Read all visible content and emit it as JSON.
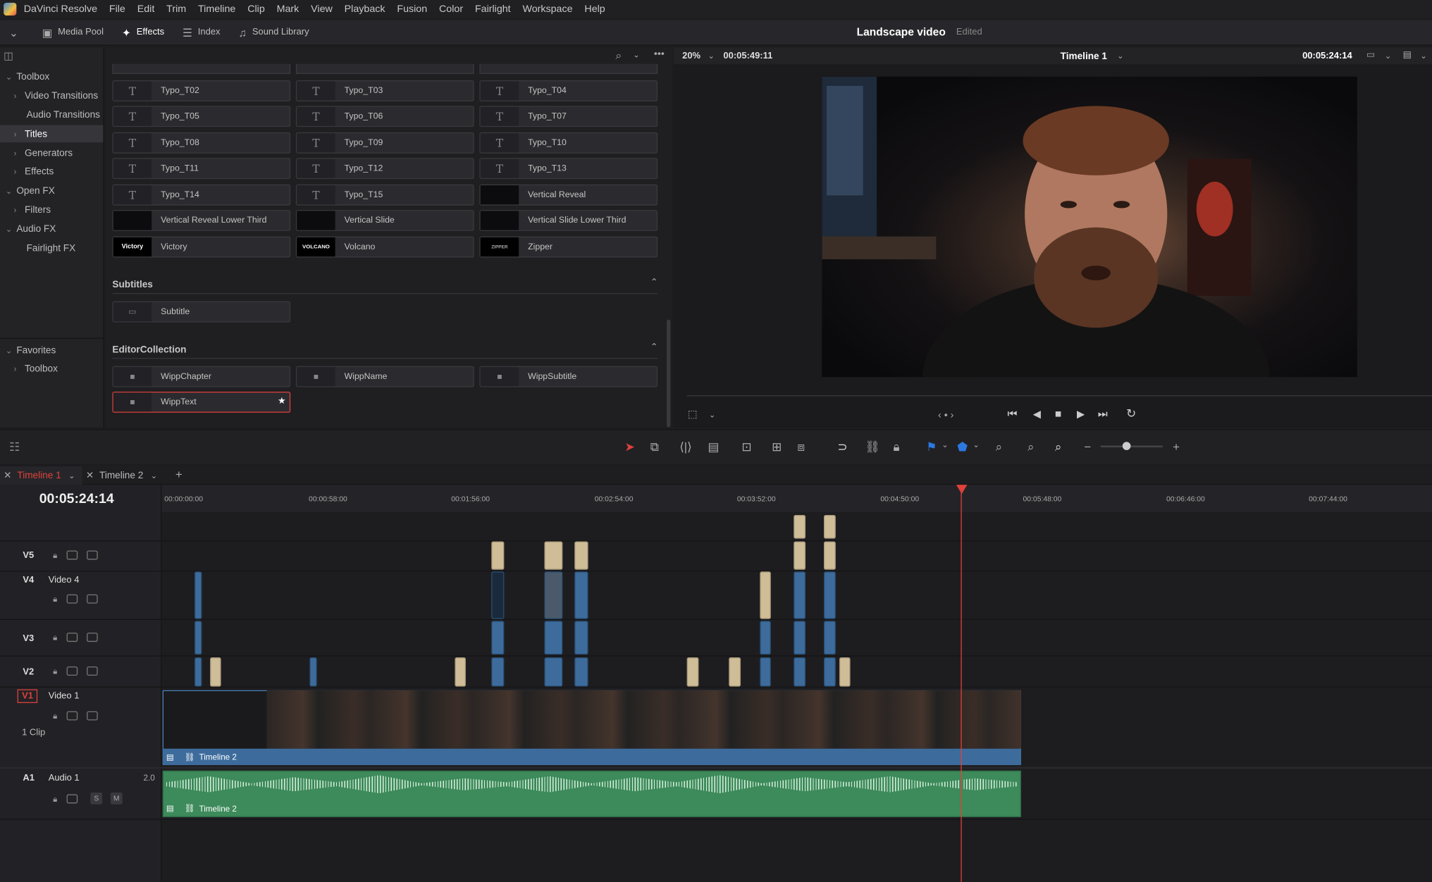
{
  "app_title": "DaVinci Resolve",
  "menu": [
    "File",
    "Edit",
    "Trim",
    "Timeline",
    "Clip",
    "Mark",
    "View",
    "Playback",
    "Fusion",
    "Color",
    "Fairlight",
    "Workspace",
    "Help"
  ],
  "page_tabs": [
    {
      "label": "Media Pool",
      "icon": "media-pool-icon"
    },
    {
      "label": "Effects",
      "icon": "effects-wand-icon",
      "active": true
    },
    {
      "label": "Index",
      "icon": "index-list-icon"
    },
    {
      "label": "Sound Library",
      "icon": "sound-library-icon"
    }
  ],
  "project": {
    "title": "Landscape video",
    "status": "Edited"
  },
  "sidebar": {
    "items": [
      {
        "label": "Toolbox",
        "expanded": true
      },
      {
        "label": "Video Transitions"
      },
      {
        "label": "Audio Transitions"
      },
      {
        "label": "Titles",
        "selected": true
      },
      {
        "label": "Generators"
      },
      {
        "label": "Effects"
      },
      {
        "label": "Open FX",
        "expanded": true
      },
      {
        "label": "Filters"
      },
      {
        "label": "Audio FX",
        "expanded": true
      },
      {
        "label": "Fairlight FX"
      },
      {
        "label": "Favorites",
        "expanded": true
      },
      {
        "label": "Toolbox"
      }
    ]
  },
  "titles_grid": [
    [
      "Typo_T02",
      "Typo_T03",
      "Typo_T04"
    ],
    [
      "Typo_T05",
      "Typo_T06",
      "Typo_T07"
    ],
    [
      "Typo_T08",
      "Typo_T09",
      "Typo_T10"
    ],
    [
      "Typo_T11",
      "Typo_T12",
      "Typo_T13"
    ],
    [
      "Typo_T14",
      "Typo_T15",
      "Vertical Reveal"
    ],
    [
      "Vertical Reveal Lower Third",
      "Vertical Slide",
      "Vertical Slide Lower Third"
    ],
    [
      "Victory",
      "Volcano",
      "Zipper"
    ]
  ],
  "thumb_text": {
    "victory": "Victory",
    "volcano": "VOLCANO",
    "zipper": "ZIPPER"
  },
  "subtitles": {
    "heading": "Subtitles",
    "items": [
      "Subtitle"
    ]
  },
  "editor_collection": {
    "heading": "EditorCollection",
    "items": [
      "WippChapter",
      "WippName",
      "WippSubtitle",
      "WippText"
    ],
    "favorite_star": "★"
  },
  "viewer": {
    "zoom": "20%",
    "source_tc": "00:05:49:11",
    "timeline": "Timeline 1",
    "record_tc": "00:05:24:14"
  },
  "timeline_tabs": [
    {
      "label": "Timeline 1",
      "active": true
    },
    {
      "label": "Timeline 2"
    }
  ],
  "timecode": "00:05:24:14",
  "ruler": [
    "00:00:00:00",
    "00:00:58:00",
    "00:01:56:00",
    "00:02:54:00",
    "00:03:52:00",
    "00:04:50:00",
    "00:05:48:00",
    "00:06:46:00",
    "00:07:44:00"
  ],
  "tracks": {
    "v5": {
      "id": "V5"
    },
    "v4": {
      "id": "V4",
      "name": "Video 4"
    },
    "v3": {
      "id": "V3"
    },
    "v2": {
      "id": "V2"
    },
    "v1": {
      "id": "V1",
      "name": "Video 1",
      "clips": "1 Clip",
      "clip_name": "Timeline 2"
    },
    "a1": {
      "id": "A1",
      "name": "Audio 1",
      "channels": "2.0",
      "solo": "S",
      "mute": "M",
      "clip_name": "Timeline 2"
    }
  },
  "colors": {
    "accent": "#e0413b",
    "video_clip": "#3d6c9c",
    "audio_clip": "#3d8a5a",
    "title_clip": "#cfbd98"
  }
}
